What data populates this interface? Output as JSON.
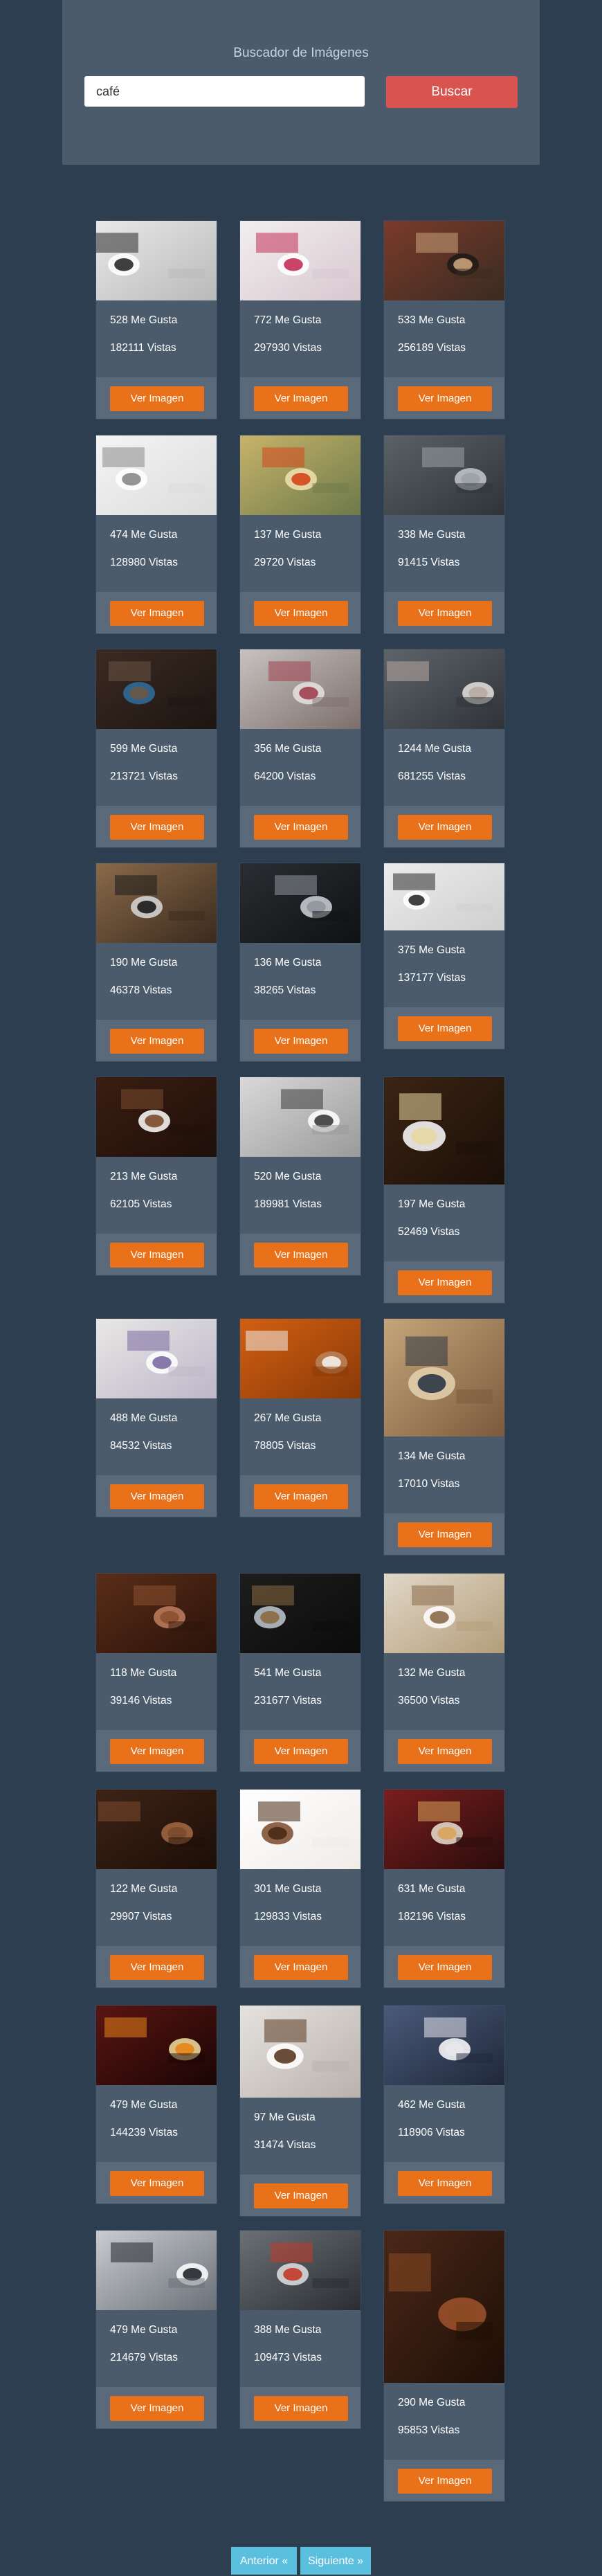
{
  "header": {
    "title": "Buscador de Imágenes"
  },
  "search": {
    "value": "café",
    "button_label": "Buscar"
  },
  "card_button_label": "Ver Imagen",
  "images": [
    {
      "likes": "528 Me Gusta",
      "views": "182111 Vistas",
      "theme": "desk-white"
    },
    {
      "likes": "772 Me Gusta",
      "views": "297930 Vistas",
      "theme": "latte-heart"
    },
    {
      "likes": "533 Me Gusta",
      "views": "256189 Vistas",
      "theme": "brick-coffee"
    },
    {
      "likes": "474 Me Gusta",
      "views": "128980 Vistas",
      "theme": "white-desk"
    },
    {
      "likes": "137 Me Gusta",
      "views": "29720 Vistas",
      "theme": "orange-mug"
    },
    {
      "likes": "338 Me Gusta",
      "views": "91415 Vistas",
      "theme": "grey-mug"
    },
    {
      "likes": "599 Me Gusta",
      "views": "213721 Vistas",
      "theme": "dark-wood"
    },
    {
      "likes": "356 Me Gusta",
      "views": "64200 Vistas",
      "theme": "cozy-bed"
    },
    {
      "likes": "1244 Me Gusta",
      "views": "681255 Vistas",
      "theme": "couple-sofa"
    },
    {
      "likes": "190 Me Gusta",
      "views": "46378 Vistas",
      "theme": "laptop-wood"
    },
    {
      "likes": "136 Me Gusta",
      "views": "38265 Vistas",
      "theme": "espresso-machine"
    },
    {
      "likes": "375 Me Gusta",
      "views": "137177 Vistas",
      "theme": "laptop-white"
    },
    {
      "likes": "213 Me Gusta",
      "views": "62105 Vistas",
      "theme": "beans-cup"
    },
    {
      "likes": "520 Me Gusta",
      "views": "189981 Vistas",
      "theme": "writing-desk"
    },
    {
      "likes": "197 Me Gusta",
      "views": "52469 Vistas",
      "theme": "cup-beans"
    },
    {
      "likes": "488 Me Gusta",
      "views": "84532 Vistas",
      "theme": "flowers-table"
    },
    {
      "likes": "267 Me Gusta",
      "views": "78805 Vistas",
      "theme": "cappuccino-orange"
    },
    {
      "likes": "134 Me Gusta",
      "views": "17010 Vistas",
      "theme": "cafe-building"
    },
    {
      "likes": "118 Me Gusta",
      "views": "39146 Vistas",
      "theme": "beans-pile"
    },
    {
      "likes": "541 Me Gusta",
      "views": "231677 Vistas",
      "theme": "laptop-dark"
    },
    {
      "likes": "132 Me Gusta",
      "views": "36500 Vistas",
      "theme": "hands-book"
    },
    {
      "likes": "122 Me Gusta",
      "views": "29907 Vistas",
      "theme": "beans-closeup"
    },
    {
      "likes": "301 Me Gusta",
      "views": "129833 Vistas",
      "theme": "beans-art"
    },
    {
      "likes": "631 Me Gusta",
      "views": "182196 Vistas",
      "theme": "red-cozy"
    },
    {
      "likes": "479 Me Gusta",
      "views": "144239 Vistas",
      "theme": "fireplace-popcorn"
    },
    {
      "likes": "97 Me Gusta",
      "views": "31474 Vistas",
      "theme": "coffee-top"
    },
    {
      "likes": "462 Me Gusta",
      "views": "118906 Vistas",
      "theme": "reading-blue"
    },
    {
      "likes": "479 Me Gusta",
      "views": "214679 Vistas",
      "theme": "tablet-coffee"
    },
    {
      "likes": "388 Me Gusta",
      "views": "109473 Vistas",
      "theme": "notebook-desk"
    },
    {
      "likes": "290 Me Gusta",
      "views": "95853 Vistas",
      "theme": "cinnamon-anise"
    }
  ],
  "pagination": {
    "prev_label": "Anterior «",
    "next_label": "Siguiente »"
  }
}
